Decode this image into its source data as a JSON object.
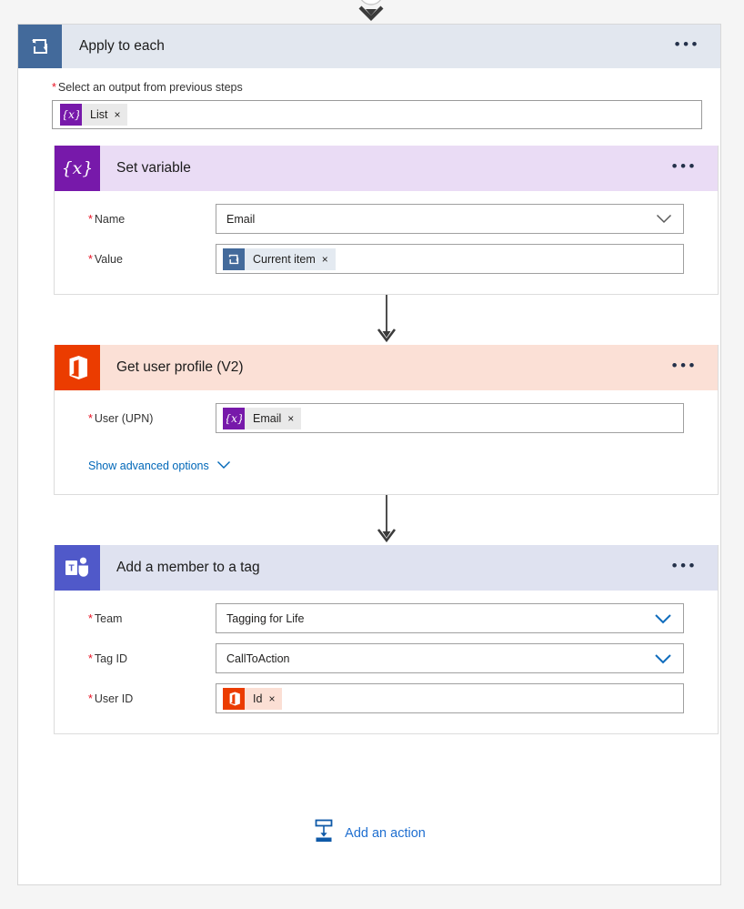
{
  "colors": {
    "loop_header_bg": "#e2e7ef",
    "loop_icon_bg": "#436a9b",
    "variable_purple": "#7719aa",
    "variable_header_bg": "#eadcf5",
    "office_orange": "#eb3c00",
    "office_header_bg": "#fbe0d6",
    "teams_blue": "#5059c9",
    "teams_header_bg": "#dfe2f0",
    "required_red": "#e81123",
    "link_blue": "#0067b8",
    "add_action_blue": "#1f6fd0"
  },
  "loop": {
    "title": "Apply to each",
    "icon": "loop-icon",
    "menu": "•••",
    "input_label": "Select an output from previous steps",
    "required_marker": "*",
    "token": {
      "text": "List",
      "icon": "variable-icon",
      "remove": "×"
    }
  },
  "actions": [
    {
      "title": "Set variable",
      "icon": "variable-icon",
      "menu": "•••",
      "fields": [
        {
          "label": "Name",
          "type": "dropdown",
          "value": "Email",
          "chevron": "chevron-down-icon",
          "chevron_color": "#5a5a5a"
        },
        {
          "label": "Value",
          "type": "token",
          "token": {
            "text": "Current item",
            "icon": "loop-icon",
            "remove": "×"
          }
        }
      ]
    },
    {
      "title": "Get user profile (V2)",
      "icon": "office365-icon",
      "menu": "•••",
      "fields": [
        {
          "label": "User (UPN)",
          "type": "token",
          "token": {
            "text": "Email",
            "icon": "variable-icon",
            "remove": "×"
          }
        }
      ],
      "advanced_link": "Show advanced options"
    },
    {
      "title": "Add a member to a tag",
      "icon": "teams-icon",
      "menu": "•••",
      "fields": [
        {
          "label": "Team",
          "type": "dropdown",
          "value": "Tagging for Life",
          "chevron": "chevron-down-icon",
          "chevron_color": "#0f6cbd"
        },
        {
          "label": "Tag ID",
          "type": "dropdown",
          "value": "CallToAction",
          "chevron": "chevron-down-icon",
          "chevron_color": "#0f6cbd"
        },
        {
          "label": "User ID",
          "type": "token",
          "token": {
            "text": "Id",
            "icon": "office365-icon",
            "remove": "×"
          }
        }
      ]
    }
  ],
  "add_action": {
    "label": "Add an action",
    "icon": "insert-action-icon"
  }
}
